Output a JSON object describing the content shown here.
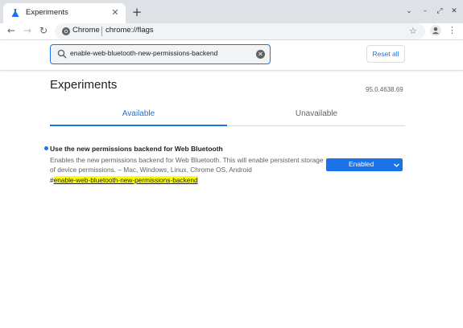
{
  "browser": {
    "tab_title": "Experiments",
    "tab_icon": "flask-icon",
    "close_glyph": "✕",
    "new_tab_glyph": "+",
    "window_controls": [
      "⌄",
      "–",
      "⤢",
      "✕"
    ],
    "back_glyph": "←",
    "forward_glyph": "→",
    "reload_glyph": "↻",
    "omnibox_origin": "Chrome",
    "omnibox_url": "chrome://flags",
    "star_glyph": "☆",
    "menu_glyph": "⋮"
  },
  "search": {
    "value": "enable-web-bluetooth-new-permissions-backend",
    "clear_glyph": "✕",
    "reset_label": "Reset all"
  },
  "page": {
    "title": "Experiments",
    "version": "95.0.4638.69",
    "tabs": [
      {
        "label": "Available",
        "active": true
      },
      {
        "label": "Unavailable",
        "active": false
      }
    ]
  },
  "experiment": {
    "name": "Use the new permissions backend for Web Bluetooth",
    "description": "Enables the new permissions backend for Web Bluetooth. This will enable persistent storage of device permissions. – Mac, Windows, Linux, Chrome OS, Android",
    "link_prefix": "#",
    "link_text": "enable-web-bluetooth-new-permissions-backend",
    "state": "Enabled"
  },
  "colors": {
    "accent": "#1a73e8",
    "highlight": "#ffff00",
    "tabstrip": "#dee1e6"
  }
}
